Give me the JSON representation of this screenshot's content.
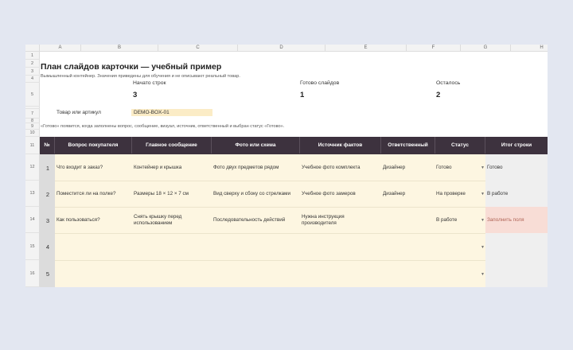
{
  "columns": [
    "A",
    "B",
    "C",
    "D",
    "E",
    "F",
    "G",
    "H"
  ],
  "rows": [
    "1",
    "2",
    "3",
    "4",
    "5",
    "6",
    "7",
    "8",
    "9",
    "10",
    "11",
    "12",
    "13",
    "14",
    "15",
    "16"
  ],
  "title": "План слайдов карточки — учебный пример",
  "subtitle": "Вымышленный контейнер. Значения приведены для обучения и не описывают реальный товар.",
  "stats": [
    {
      "label": "Начато строк",
      "value": "3"
    },
    {
      "label": "Готово слайдов",
      "value": "1"
    },
    {
      "label": "Осталось",
      "value": "2"
    }
  ],
  "product": {
    "label": "Товар или артикул",
    "value": "DEMO-BOX-01"
  },
  "note": "«Готово» появится, когда заполнены вопрос, сообщение, визуал, источник, ответственный и выбран статус «Готово».",
  "table_headers": [
    "№",
    "Вопрос покупателя",
    "Главное сообщение",
    "Фото или схема",
    "Источник фактов",
    "Ответственный",
    "Статус",
    "Итог строки"
  ],
  "table_rows": [
    {
      "num": "1",
      "question": "Что входит в заказ?",
      "message": "Контейнер и крышка",
      "visual": "Фото двух предметов рядом",
      "source": "Учебное фото комплекта",
      "owner": "Дизайнер",
      "status": "Готово",
      "result": "Готово"
    },
    {
      "num": "2",
      "question": "Поместится ли на полке?",
      "message": "Размеры 18 × 12 × 7 см",
      "visual": "Вид сверху и сбоку со стрелками",
      "source": "Учебное фото замеров",
      "owner": "Дизайнер",
      "status": "На проверке",
      "result": "В работе"
    },
    {
      "num": "3",
      "question": "Как пользоваться?",
      "message": "Снять крышку перед использованием",
      "visual": "Последовательность действий",
      "source": "Нужна инструкция производителя",
      "owner": "",
      "status": "В работе",
      "result": "Заполнить поля"
    },
    {
      "num": "4",
      "question": "",
      "message": "",
      "visual": "",
      "source": "",
      "owner": "",
      "status": "",
      "result": ""
    },
    {
      "num": "5",
      "question": "",
      "message": "",
      "visual": "",
      "source": "",
      "owner": "",
      "status": "",
      "result": ""
    }
  ],
  "dropdown_icon": "triangle-down-icon",
  "colors": {
    "header_band": "#3d323e",
    "input_cell": "#fdf6e1",
    "result_cell": "#efefef",
    "warning_cell": "#f8ddd6",
    "field_highlight": "#fbecc6"
  }
}
